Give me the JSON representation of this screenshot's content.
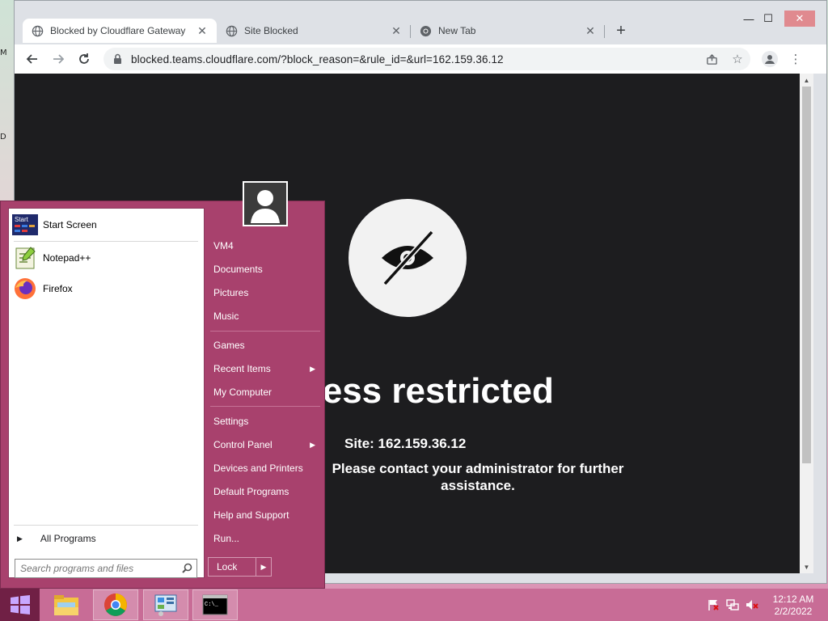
{
  "desktop": {
    "edge_marks": [
      "M",
      "D"
    ]
  },
  "browser": {
    "tabs": [
      {
        "label": "Blocked by Cloudflare Gateway",
        "icon": "globe-icon",
        "active": true
      },
      {
        "label": "Site Blocked",
        "icon": "globe-icon",
        "active": false
      },
      {
        "label": "New Tab",
        "icon": "chrome-icon",
        "active": false
      }
    ],
    "new_tab_label": "+",
    "window_controls": {
      "minimize": "—",
      "maximize": "☐",
      "close": "✕"
    },
    "url": "blocked.teams.cloudflare.com/?block_reason=&rule_id=&url=162.159.36.12",
    "page": {
      "title": "Access restricted",
      "site": "Site: 162.159.36.12",
      "message": "Please contact your administrator for further assistance."
    }
  },
  "start_menu": {
    "pinned": [
      {
        "label": "Start Screen",
        "icon": "start-screen-icon"
      },
      {
        "label": "Notepad++",
        "icon": "notepadpp-icon"
      },
      {
        "label": "Firefox",
        "icon": "firefox-icon"
      }
    ],
    "start_screen_badge": "Start",
    "all_programs": "All Programs",
    "search_placeholder": "Search programs and files",
    "right_items": [
      {
        "label": "VM4",
        "submenu": false
      },
      {
        "label": "Documents",
        "submenu": false
      },
      {
        "label": "Pictures",
        "submenu": false
      },
      {
        "label": "Music",
        "submenu": false
      },
      {
        "label": "Games",
        "submenu": false
      },
      {
        "label": "Recent Items",
        "submenu": true
      },
      {
        "label": "My Computer",
        "submenu": false
      },
      {
        "label": "Settings",
        "submenu": false
      },
      {
        "label": "Control Panel",
        "submenu": true
      },
      {
        "label": "Devices and Printers",
        "submenu": false
      },
      {
        "label": "Default Programs",
        "submenu": false
      },
      {
        "label": "Help and Support",
        "submenu": false
      },
      {
        "label": "Run...",
        "submenu": false
      }
    ],
    "lock_label": "Lock"
  },
  "taskbar": {
    "apps": [
      "file-explorer-icon",
      "chrome-icon",
      "control-panel-icon",
      "command-prompt-icon"
    ],
    "cmd_badge": "C:\\_",
    "tray": [
      "action-center-flag-icon",
      "network-icon",
      "volume-muted-icon"
    ],
    "time": "12:12 AM",
    "date": "2/2/2022"
  },
  "colors": {
    "start_menu": "#a8416d",
    "taskbar": "#c86c96",
    "page_bg": "#1d1d1f"
  }
}
